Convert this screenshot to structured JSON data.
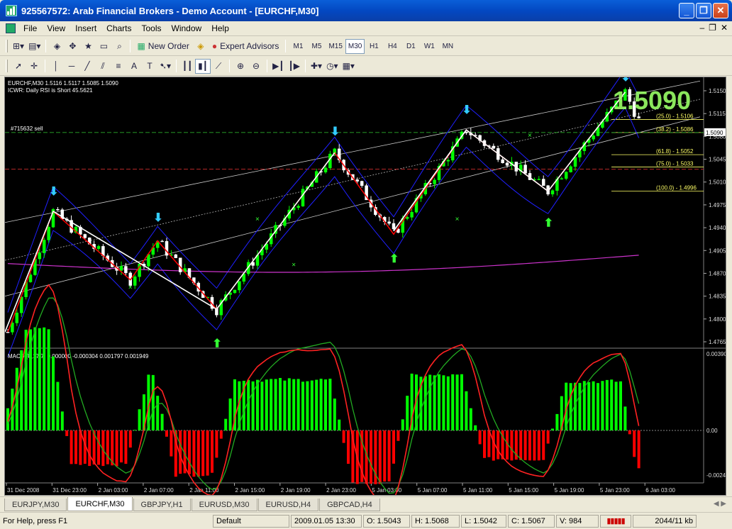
{
  "window": {
    "title": "925567572: Arab Financial Brokers - Demo Account - [EURCHF,M30]"
  },
  "menu": [
    "File",
    "View",
    "Insert",
    "Charts",
    "Tools",
    "Window",
    "Help"
  ],
  "toolbar": {
    "new_order": "New Order",
    "expert_advisors": "Expert Advisors",
    "timeframes": [
      "M1",
      "M5",
      "M15",
      "M30",
      "H1",
      "H4",
      "D1",
      "W1",
      "MN"
    ],
    "selected_timeframe": "M30"
  },
  "chart": {
    "header": "EURCHF,M30  1.5116 1.5117 1.5085 1.5090",
    "indicator_line": "ICWR: Daily RSI is Short 45.5621",
    "order_label": "#715632 sell",
    "big_price": "1.5090",
    "current_price": "1.5090",
    "price_axis": [
      "1.5150",
      "1.5115",
      "1.5080",
      "1.5045",
      "1.5010",
      "1.4975",
      "1.4940",
      "1.4905",
      "1.4870",
      "1.4835",
      "1.4800",
      "1.4765"
    ],
    "fib_levels": [
      {
        "label": "(25.0) - 1.5106",
        "value": 1.5106
      },
      {
        "label": "(38.2) - 1.5086",
        "value": 1.5086
      },
      {
        "label": "(61.8) - 1.5052",
        "value": 1.5052
      },
      {
        "label": "(75.0) - 1.5033",
        "value": 1.5033
      },
      {
        "label": "(100.0) - 1.4996",
        "value": 1.4996
      }
    ],
    "time_axis": [
      "31 Dec 2008",
      "31 Dec 23:00",
      "2 Jan 03:00",
      "2 Jan 07:00",
      "2 Jan 11:00",
      "2 Jan 15:00",
      "2 Jan 19:00",
      "2 Jan 23:00",
      "5 Jan 03:00",
      "5 Jan 07:00",
      "5 Jan 11:00",
      "5 Jan 15:00",
      "5 Jan 19:00",
      "5 Jan 23:00",
      "6 Jan 03:00"
    ],
    "macd_header": "MACD (8,17,7) 0.000000 -0.000304 0.001797 0.001949",
    "macd_axis": [
      "0.003909",
      "0.00",
      "-0.002423"
    ],
    "colors": {
      "up": "#00ff00",
      "down": "#ff0000",
      "band": "#2020ff",
      "zigzag": "#ff0000",
      "trend": "#ffffff",
      "sma": "#cc33cc",
      "fib": "#ffff66",
      "arrow": "#33ccff"
    }
  },
  "tabs": [
    "EURJPY,M30",
    "EURCHF,M30",
    "GBPJPY,H1",
    "EURUSD,M30",
    "EURUSD,H4",
    "GBPCAD,H4"
  ],
  "active_tab": "EURCHF,M30",
  "status": {
    "help": "For Help, press F1",
    "profile": "Default",
    "datetime": "2009.01.05 13:30",
    "open": "O: 1.5043",
    "high": "H: 1.5068",
    "low": "L: 1.5042",
    "close": "C: 1.5067",
    "volume": "V: 984",
    "traffic": "2044/11 kb"
  }
}
